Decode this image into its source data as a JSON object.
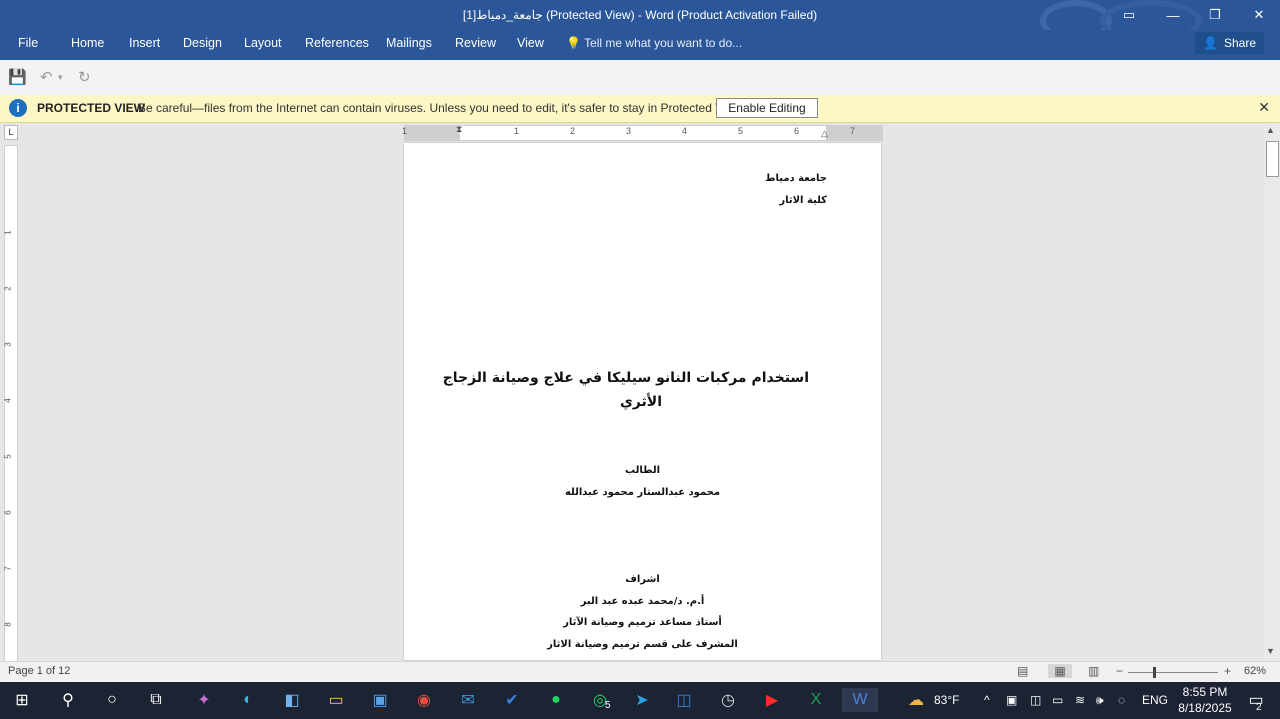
{
  "window": {
    "title": "جامعة_دمياط[1] (Protected View) - Word (Product Activation Failed)",
    "restore_icon": "ribbon-display-icon",
    "minimize": "—",
    "maximize": "❐",
    "close": "✕"
  },
  "ribbon": {
    "tabs": [
      "File",
      "Home",
      "Insert",
      "Design",
      "Layout",
      "References",
      "Mailings",
      "Review",
      "View"
    ],
    "tell_me": "Tell me what you want to do...",
    "share": "Share"
  },
  "protected_view": {
    "label": "PROTECTED VIEW",
    "message": "Be careful—files from the Internet can contain viruses. Unless you need to edit, it's safer to stay in Protected View.",
    "enable_button": "Enable Editing"
  },
  "ruler": {
    "numbers": [
      "1",
      "1",
      "2",
      "3",
      "4",
      "5",
      "6",
      "7"
    ],
    "left_numbers": [
      "1",
      "2",
      "3",
      "4",
      "5",
      "6",
      "7",
      "8"
    ]
  },
  "document": {
    "university": "جامعة دمياط",
    "faculty": "كلية الاثار",
    "title_line1": "استخدام مركبات النانو سيليكا في علاج وصيانة الزجاج",
    "title_line2": "الأثري",
    "student_label": "الطالب",
    "student_name": "محمود عبدالستار محمود عبدالله",
    "supervision_label": "اشراف",
    "supervisor_name": "أ.م. د/محمد عبده عبد البر",
    "supervisor_title": "أستاذ مساعد ترميم وصيانة الآثار",
    "supervisor_role": "المشرف على قسم ترميم وصيانة الاثار"
  },
  "status": {
    "page_info": "Page 1 of 12",
    "zoom": "62%",
    "zoom_minus": "−",
    "zoom_plus": "+"
  },
  "taskbar": {
    "whatsapp_badge": "5",
    "temperature": "83°F",
    "language": "ENG",
    "time": "8:55 PM",
    "date": "8/18/2025",
    "notifications": "2"
  },
  "colors": {
    "word_blue": "#2b579a",
    "protected_bar": "#fdf6c5",
    "taskbar": "#1c2333"
  }
}
